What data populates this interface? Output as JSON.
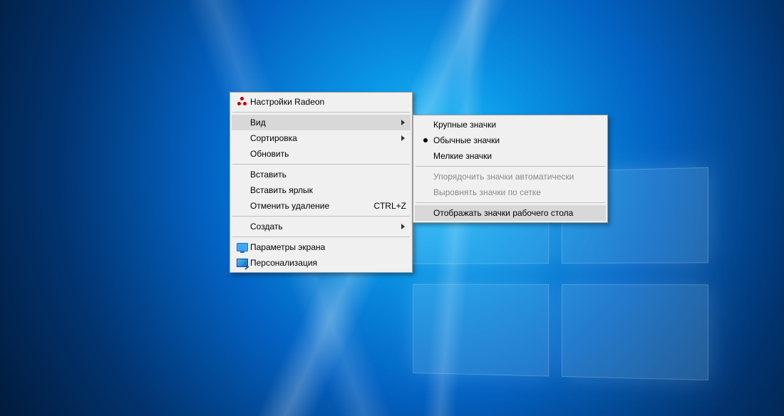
{
  "mainMenu": {
    "radeon": "Настройки Radeon",
    "view": "Вид",
    "sort": "Сортировка",
    "refresh": "Обновить",
    "paste": "Вставить",
    "pasteShortcut": "Вставить ярлык",
    "undoDelete": "Отменить удаление",
    "undoShortcut": "CTRL+Z",
    "new": "Создать",
    "display": "Параметры экрана",
    "personalize": "Персонализация"
  },
  "subMenu": {
    "large": "Крупные значки",
    "medium": "Обычные значки",
    "small": "Мелкие значки",
    "autoArrange": "Упорядочить значки автоматически",
    "alignGrid": "Выровнять значки по сетке",
    "showIcons": "Отображать значки рабочего стола"
  }
}
